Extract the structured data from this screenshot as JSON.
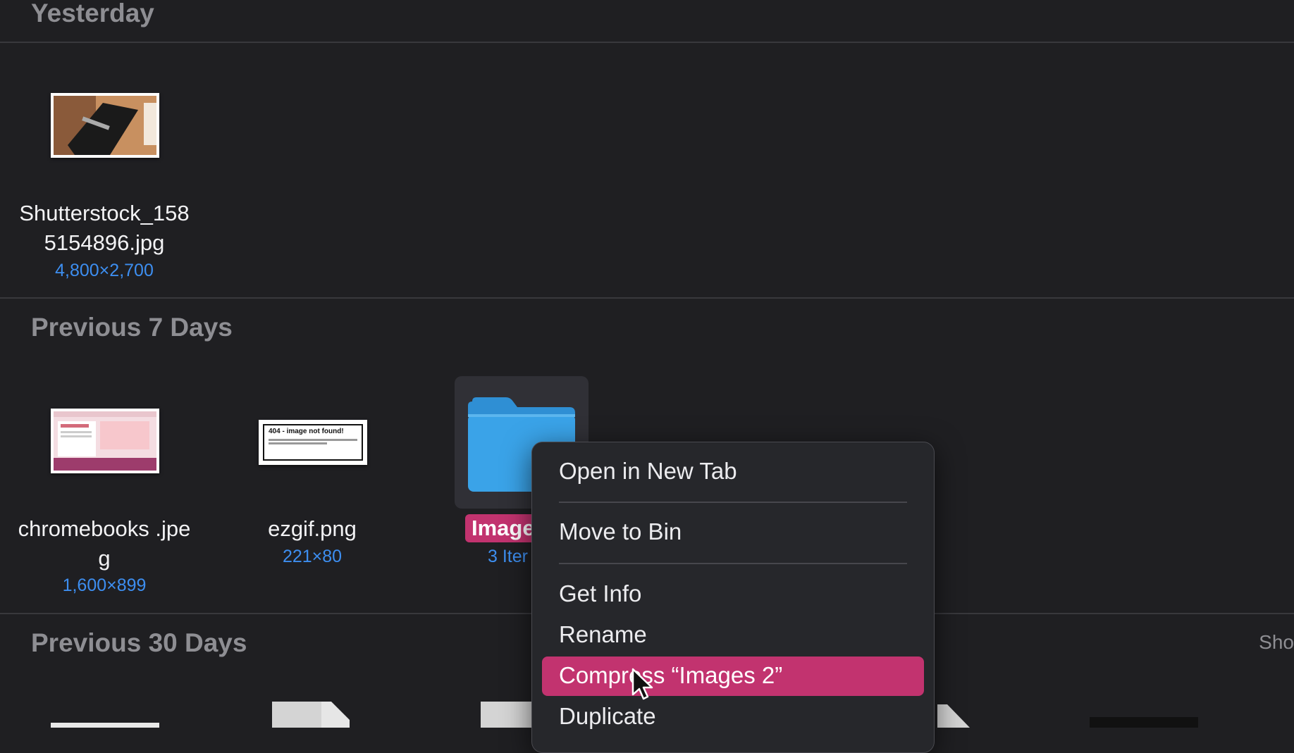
{
  "sections": {
    "yesterday": "Yesterday",
    "prev7": "Previous 7 Days",
    "prev30": "Previous 30 Days"
  },
  "files": {
    "shutterstock": {
      "name_line1": "Shutterstock_158",
      "name_line2": "5154896.jpg",
      "meta": "4,800×2,700"
    },
    "chromebooks": {
      "name_line1": "chromebooks .jpe",
      "name_line2": "g",
      "meta": "1,600×899"
    },
    "ezgif": {
      "name": "ezgif.png",
      "meta": "221×80",
      "thumb_text": "404 - image not found!"
    },
    "folder": {
      "name_visible": "Image",
      "meta_visible": "3 Iter"
    }
  },
  "context_menu": {
    "open_new_tab": "Open in New Tab",
    "move_to_bin": "Move to Bin",
    "get_info": "Get Info",
    "rename": "Rename",
    "compress": "Compress “Images 2”",
    "duplicate": "Duplicate"
  },
  "right_edge_text": "Sho",
  "colors": {
    "background": "#1f1f22",
    "accent_pink": "#c2336f",
    "meta_blue": "#3d8ef0",
    "folder_blue": "#3aa3e8"
  }
}
